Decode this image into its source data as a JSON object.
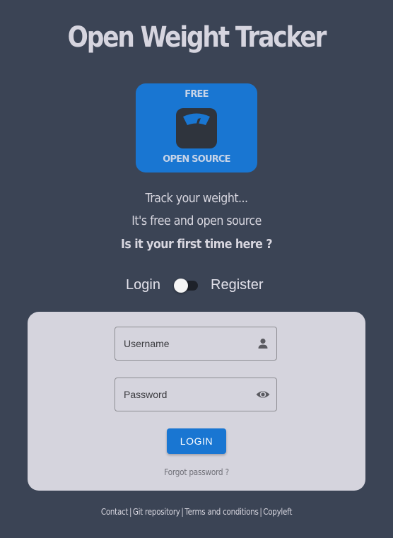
{
  "app": {
    "title": "Open Weight Tracker"
  },
  "logo": {
    "top_text": "FREE",
    "bottom_text": "OPEN SOURCE",
    "icon": "bathroom-scale-icon",
    "bg_color": "#1976d2"
  },
  "tagline": {
    "line1": "Track your weight...",
    "line2": "It's free and open source",
    "line3": "Is it your first time here ?"
  },
  "mode_toggle": {
    "left_label": "Login",
    "right_label": "Register",
    "checked": false
  },
  "form": {
    "username": {
      "placeholder": "Username",
      "value": "",
      "icon": "person-icon"
    },
    "password": {
      "placeholder": "Password",
      "value": "",
      "icon": "eye-icon"
    },
    "submit_label": "LOGIN",
    "forgot_label": "Forgot password ?"
  },
  "footer": {
    "links": [
      "Contact",
      "Git repository",
      "Terms and conditions",
      "Copyleft"
    ],
    "separator": "|"
  },
  "colors": {
    "background": "#3b4455",
    "card": "#d5d4dd",
    "accent": "#1976d2"
  }
}
